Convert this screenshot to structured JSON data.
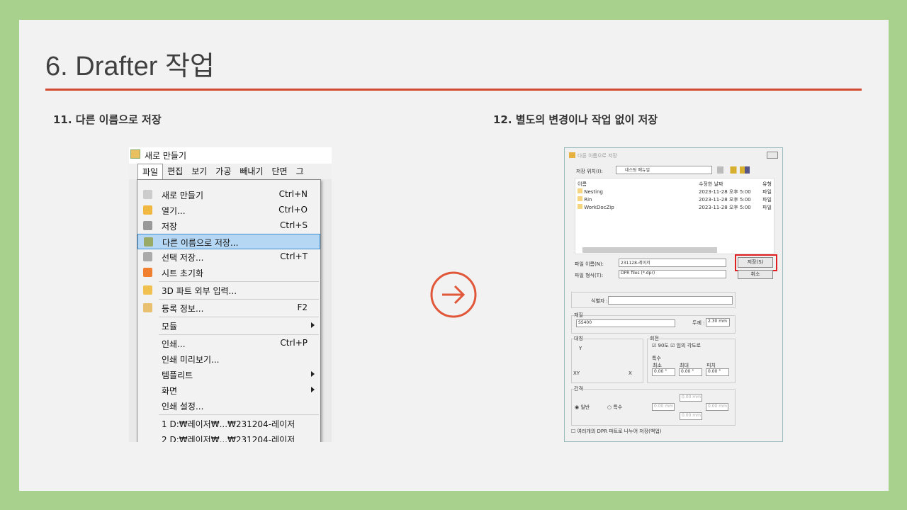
{
  "slide": {
    "title": "6. Drafter 작업",
    "step11": "11.  다른 이름으로 저장",
    "step12": "12.  별도의 변경이나 작업 없이 저장",
    "accent": "#d24b2e"
  },
  "left_shot": {
    "window_title": "새로 만들기",
    "menubar": [
      "파일",
      "편집",
      "보기",
      "가공",
      "빼내기",
      "단면",
      "그"
    ],
    "menu": [
      {
        "label": "새로 만들기",
        "shortcut": "Ctrl+N"
      },
      {
        "label": "열기...",
        "shortcut": "Ctrl+O"
      },
      {
        "label": "저장",
        "shortcut": "Ctrl+S"
      },
      {
        "label": "다른 이름으로 저장...",
        "shortcut": ""
      },
      {
        "label": "선택 저장...",
        "shortcut": "Ctrl+T"
      },
      {
        "label": "시트 초기화",
        "shortcut": ""
      },
      {
        "label": "3D 파트 외부 입력...",
        "shortcut": ""
      },
      {
        "label": "등록 정보...",
        "shortcut": "F2"
      },
      {
        "label": "모듈",
        "shortcut": ""
      },
      {
        "label": "인쇄...",
        "shortcut": "Ctrl+P"
      },
      {
        "label": "인쇄 미리보기...",
        "shortcut": ""
      },
      {
        "label": "템플리트",
        "shortcut": ""
      },
      {
        "label": "화면",
        "shortcut": ""
      },
      {
        "label": "인쇄 설정...",
        "shortcut": ""
      },
      {
        "label": "1 D:₩레이저₩...₩231204-레이저",
        "shortcut": ""
      },
      {
        "label": "2 D:₩레이저₩...₩231204-레이저",
        "shortcut": ""
      }
    ]
  },
  "dialog": {
    "title": "다른 이름으로 저장",
    "location_label": "저장 위치(I):",
    "location": "네스팅 매뉴얼",
    "columns": [
      "이름",
      "수정한 날짜",
      "유형"
    ],
    "files": [
      {
        "name": "Nesting",
        "date": "2023-11-28 오후 5:00",
        "type": "파일"
      },
      {
        "name": "Rin",
        "date": "2023-11-28 오후 5:00",
        "type": "파일"
      },
      {
        "name": "WorkDocZip",
        "date": "2023-11-28 오후 5:00",
        "type": "파일"
      }
    ],
    "filename_label": "파일 이름(N):",
    "filename": "231128-레이저",
    "filetype_label": "파일 형식(T):",
    "filetype": "DPR files (*.dpr)",
    "save": "저장(S)",
    "cancel": "취소",
    "identifier_label": "식별자 :",
    "material_group": "재질",
    "material": "SS400",
    "thickness_label": "두께 :",
    "thickness": "2.30 mm",
    "symmetry_group": "대칭",
    "y": "Y",
    "xy": "XY",
    "x": "X",
    "rotation_group": "회전",
    "rot90": "90도",
    "rot_any": "임의 각도로",
    "special_group": "특수",
    "min": "최소",
    "max": "최대",
    "pitch": "피치",
    "angle": "0.00 °",
    "gap_group": "간격",
    "normal": "일반",
    "special": "특수",
    "mm": "0.00 mm",
    "split_label": "여러개의 DPR 파트로 나누어 저장(백업)"
  }
}
